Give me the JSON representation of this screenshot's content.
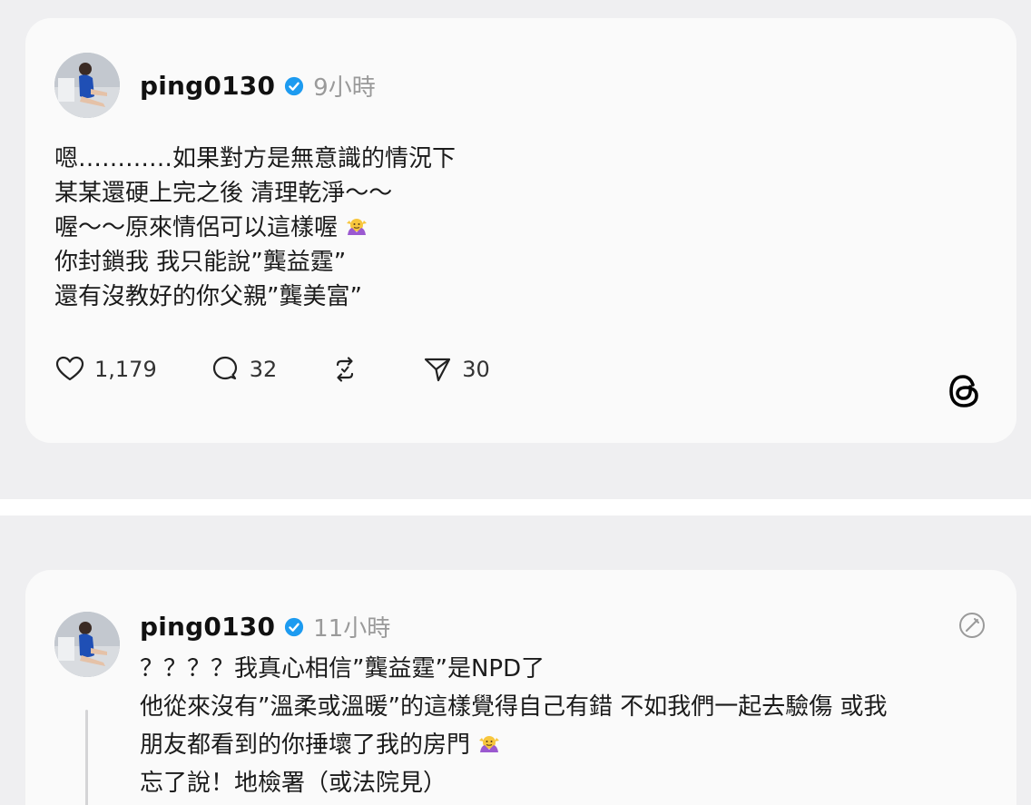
{
  "post1": {
    "username": "ping0130",
    "time": "9小時",
    "lines": [
      "嗯…………如果對方是無意識的情況下",
      "某某還硬上完之後 清理乾淨～～",
      "喔～～原來情侶可以這樣喔",
      "你封鎖我 我只能說”龔益霆”",
      "還有沒教好的你父親”龔美富”"
    ],
    "emoji_line_index": 2,
    "emoji_name": "shrug-emoji",
    "actions": {
      "likes": "1,179",
      "replies": "32",
      "reposts": "",
      "shares": "30"
    }
  },
  "post2": {
    "username": "ping0130",
    "time": "11小時",
    "lines": [
      "？？？？我真心相信”龔益霆”是NPD了",
      "他從來沒有”溫柔或溫暖”的這樣覺得自己有錯 不如我們一起去驗傷 或我",
      "朋友都看到的你捶壞了我的房門",
      "忘了說！地檢署（或法院見）"
    ],
    "emoji_line_index": 2,
    "emoji_name": "shrug-emoji"
  },
  "colors": {
    "background": "#efeff1",
    "card": "#fafafa",
    "verified": "#1d9bf0",
    "muted_text": "#9a9a9a"
  },
  "icons": [
    "heart-icon",
    "reply-icon",
    "repost-icon",
    "share-icon",
    "threads-logo-icon",
    "verified-badge-icon",
    "edit-icon"
  ]
}
